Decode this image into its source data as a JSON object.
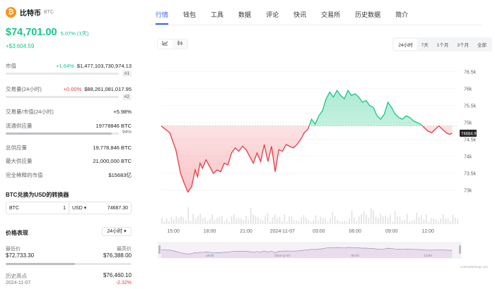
{
  "coin": {
    "name": "比特币",
    "symbol": "BTC",
    "logo_glyph": "₿"
  },
  "price": {
    "value": "$74,701.00",
    "pct": "5.07%",
    "period": "(1天)",
    "change": "+$3,604.59"
  },
  "stats": {
    "market_cap": {
      "label": "市值",
      "change": "+1.64%",
      "value": "$1,477,103,730,974.13",
      "rank": "#1",
      "bar_fraction": 1.0
    },
    "volume": {
      "label": "交易量(24小时)",
      "change": "+0.00%",
      "value": "$88,261,081,017.95",
      "rank": "#2",
      "bar_fraction": 1.0
    },
    "vol_mcap": {
      "label": "交易量/市值(24小时)",
      "value": "+5.98%"
    },
    "circ_supply": {
      "label": "流通供应量",
      "value": "19778846 BTC",
      "pct": "94%",
      "bar_fraction": 0.94
    },
    "total_supply": {
      "label": "总供应量",
      "value": "19,778,846 BTC"
    },
    "max_supply": {
      "label": "最大供应量",
      "value": "21,000,000 BTC"
    },
    "fdv": {
      "label": "完全稀释的市值",
      "value": "$15683亿"
    }
  },
  "converter": {
    "title": "BTC兑换为USD的转换器",
    "from_currency": "BTC",
    "from_amount": "1",
    "to_currency": "USD ▾",
    "to_amount": "74687.30"
  },
  "performance": {
    "title": "价格表现",
    "period": "24小时 ▾",
    "low_label": "最低价",
    "low_value": "$72,733.30",
    "high_label": "最高价",
    "high_value": "$76,388.00",
    "ath_label": "历史高点",
    "ath_value": "$76,460.10",
    "ath_date": "2024-11-07",
    "ath_change": "-2.32%",
    "range_fraction": 0.55
  },
  "tabs": [
    "行情",
    "钱包",
    "工具",
    "数据",
    "评论",
    "快讯",
    "交易所",
    "历史数据",
    "简介"
  ],
  "active_tab": 0,
  "chart_controls": {
    "type_icons": [
      "line-chart-icon",
      "candlestick-icon"
    ],
    "ranges": [
      "24小时",
      "7天",
      "1个月",
      "3个月",
      "全部"
    ],
    "active_range": 0
  },
  "watermark": "coinmarketcap.com",
  "colors": {
    "up": "#16c784",
    "down": "#ea3943",
    "accent": "#3861fb"
  },
  "chart_data": {
    "type": "area",
    "baseline": 74900,
    "current_label": "74684.9",
    "y_ticks": [
      "76.5k",
      "76k",
      "75.5k",
      "75k",
      "74.5k",
      "74k",
      "73.5k",
      "73k"
    ],
    "y_tick_values": [
      76500,
      76000,
      75500,
      75000,
      74500,
      74000,
      73500,
      73000
    ],
    "ylim": [
      72750,
      76600
    ],
    "x_ticks": [
      "15:00",
      "18:00",
      "21:00",
      "2024-11-07",
      "03:00",
      "06:00",
      "09:00",
      "12:00"
    ],
    "x_tick_positions": [
      1,
      4,
      7,
      10,
      13,
      16,
      19,
      22
    ],
    "xlim": [
      0,
      24.5
    ],
    "mini_x_ticks": [
      "18:00",
      "2024-11-07",
      "06:00",
      "12:00"
    ],
    "mini_x_tick_positions": [
      4,
      10,
      16,
      22
    ],
    "x": [
      0,
      0.7,
      1.2,
      1.6,
      1.9,
      2.2,
      2.5,
      2.8,
      3.0,
      3.2,
      3.4,
      3.7,
      4.0,
      4.3,
      4.6,
      4.9,
      5.2,
      5.5,
      5.8,
      6.1,
      6.4,
      6.7,
      7.0,
      7.3,
      7.6,
      7.9,
      8.2,
      8.5,
      8.8,
      9.1,
      9.4,
      9.7,
      10.0,
      10.3,
      10.6,
      10.9,
      11.2,
      11.5,
      11.8,
      12.1,
      12.4,
      12.7,
      13.0,
      13.3,
      13.6,
      13.9,
      14.2,
      14.5,
      14.8,
      15.1,
      15.4,
      15.7,
      16.0,
      16.3,
      16.6,
      16.9,
      17.2,
      17.5,
      17.8,
      18.1,
      18.4,
      18.7,
      19.0,
      19.3,
      19.6,
      19.9,
      20.2,
      20.5,
      20.8,
      21.1,
      21.4,
      21.7,
      22.0,
      22.3,
      22.6,
      22.9,
      23.2,
      23.5,
      23.8,
      24.0
    ],
    "y": [
      74900,
      74700,
      74200,
      73500,
      73200,
      72950,
      73100,
      73600,
      73400,
      73800,
      73650,
      73900,
      73700,
      73500,
      73600,
      73550,
      73800,
      73750,
      74100,
      74250,
      74150,
      74300,
      74200,
      74000,
      73800,
      74100,
      73850,
      74350,
      73850,
      74300,
      73550,
      74200,
      74150,
      74350,
      74300,
      74250,
      74350,
      74500,
      74700,
      74800,
      75100,
      74950,
      75200,
      75350,
      75700,
      75900,
      75750,
      75950,
      75800,
      75700,
      75950,
      75800,
      75850,
      75750,
      75600,
      75650,
      75500,
      75450,
      75200,
      75100,
      75250,
      75600,
      75450,
      75250,
      75150,
      75100,
      75200,
      75150,
      75050,
      75000,
      74950,
      74850,
      74750,
      74700,
      74800,
      74900,
      74800,
      74700,
      74650,
      74685
    ]
  }
}
